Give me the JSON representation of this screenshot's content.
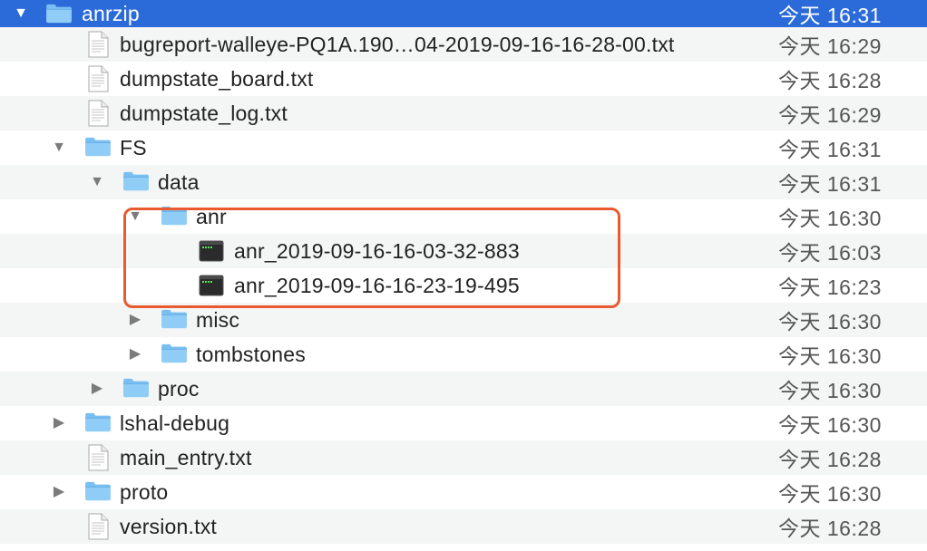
{
  "rows": [
    {
      "name": "anrzip",
      "date": "今天 16:31"
    },
    {
      "name": "bugreport-walleye-PQ1A.190…04-2019-09-16-16-28-00.txt",
      "date": "今天 16:29"
    },
    {
      "name": "dumpstate_board.txt",
      "date": "今天 16:28"
    },
    {
      "name": "dumpstate_log.txt",
      "date": "今天 16:29"
    },
    {
      "name": "FS",
      "date": "今天 16:31"
    },
    {
      "name": "data",
      "date": "今天 16:31"
    },
    {
      "name": "anr",
      "date": "今天 16:30"
    },
    {
      "name": "anr_2019-09-16-16-03-32-883",
      "date": "今天 16:03"
    },
    {
      "name": "anr_2019-09-16-16-23-19-495",
      "date": "今天 16:23"
    },
    {
      "name": "misc",
      "date": "今天 16:30"
    },
    {
      "name": "tombstones",
      "date": "今天 16:30"
    },
    {
      "name": "proc",
      "date": "今天 16:30"
    },
    {
      "name": "lshal-debug",
      "date": "今天 16:30"
    },
    {
      "name": "main_entry.txt",
      "date": "今天 16:28"
    },
    {
      "name": "proto",
      "date": "今天 16:30"
    },
    {
      "name": "version.txt",
      "date": "今天 16:28"
    }
  ],
  "colors": {
    "selection": "#2b6ad9",
    "highlight_box": "#e85a30",
    "folder": "#7fc4f5"
  }
}
